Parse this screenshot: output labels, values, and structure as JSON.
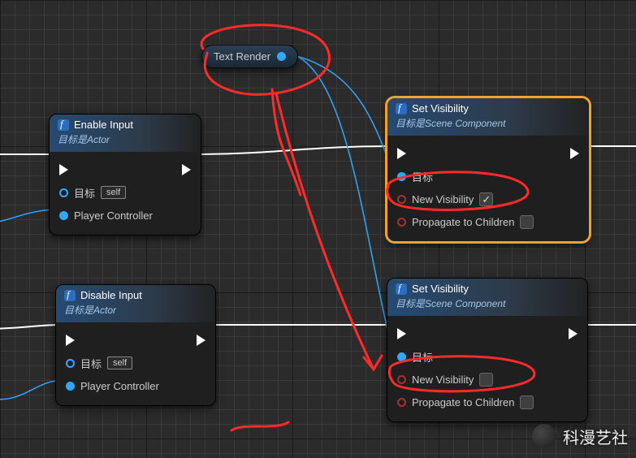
{
  "mini_node": {
    "label": "Text Render"
  },
  "nodes": {
    "enable_input": {
      "title": "Enable Input",
      "subtitle": "目标是Actor",
      "target_label": "目标",
      "self_label": "self",
      "player_controller_label": "Player Controller"
    },
    "disable_input": {
      "title": "Disable Input",
      "subtitle": "目标是Actor",
      "target_label": "目标",
      "self_label": "self",
      "player_controller_label": "Player Controller"
    },
    "set_vis_top": {
      "title": "Set Visibility",
      "subtitle": "目标是Scene Component",
      "target_label": "目标",
      "new_visibility_label": "New Visibility",
      "new_visibility_checked": true,
      "propagate_label": "Propagate to Children",
      "propagate_checked": false
    },
    "set_vis_bottom": {
      "title": "Set Visibility",
      "subtitle": "目标是Scene Component",
      "target_label": "目标",
      "new_visibility_label": "New Visibility",
      "new_visibility_checked": false,
      "propagate_label": "Propagate to Children",
      "propagate_checked": false
    }
  },
  "watermark": {
    "text": "科漫艺社"
  },
  "colors": {
    "exec_wire": "#ffffff",
    "obj_wire": "#2fa8ff",
    "annotation": "#ff2a2a",
    "selected": "#f4a22a"
  }
}
